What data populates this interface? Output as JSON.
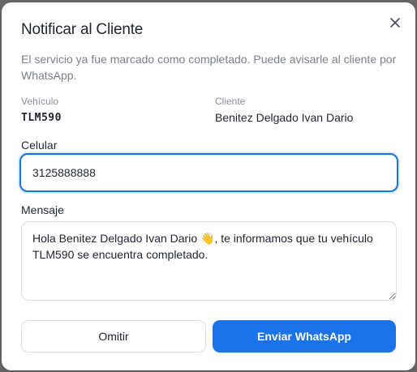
{
  "modal": {
    "title": "Notificar al Cliente",
    "description": "El servicio ya fue marcado como completado. Puede avisarle al cliente por WhatsApp.",
    "close_icon": "close-icon"
  },
  "vehicle": {
    "label": "Vehículo",
    "value": "TLM590"
  },
  "client": {
    "label": "Cliente",
    "value": "Benitez Delgado Ivan Dario"
  },
  "phone": {
    "label": "Celular",
    "value": "3125888888"
  },
  "message": {
    "label": "Mensaje",
    "value": "Hola Benitez Delgado Ivan Dario 👋, te informamos que tu vehículo TLM590 se encuentra completado."
  },
  "actions": {
    "skip_label": "Omitir",
    "send_label": "Enviar WhatsApp"
  },
  "colors": {
    "accent": "#1a73e8",
    "focus_border": "#1a73d9"
  }
}
